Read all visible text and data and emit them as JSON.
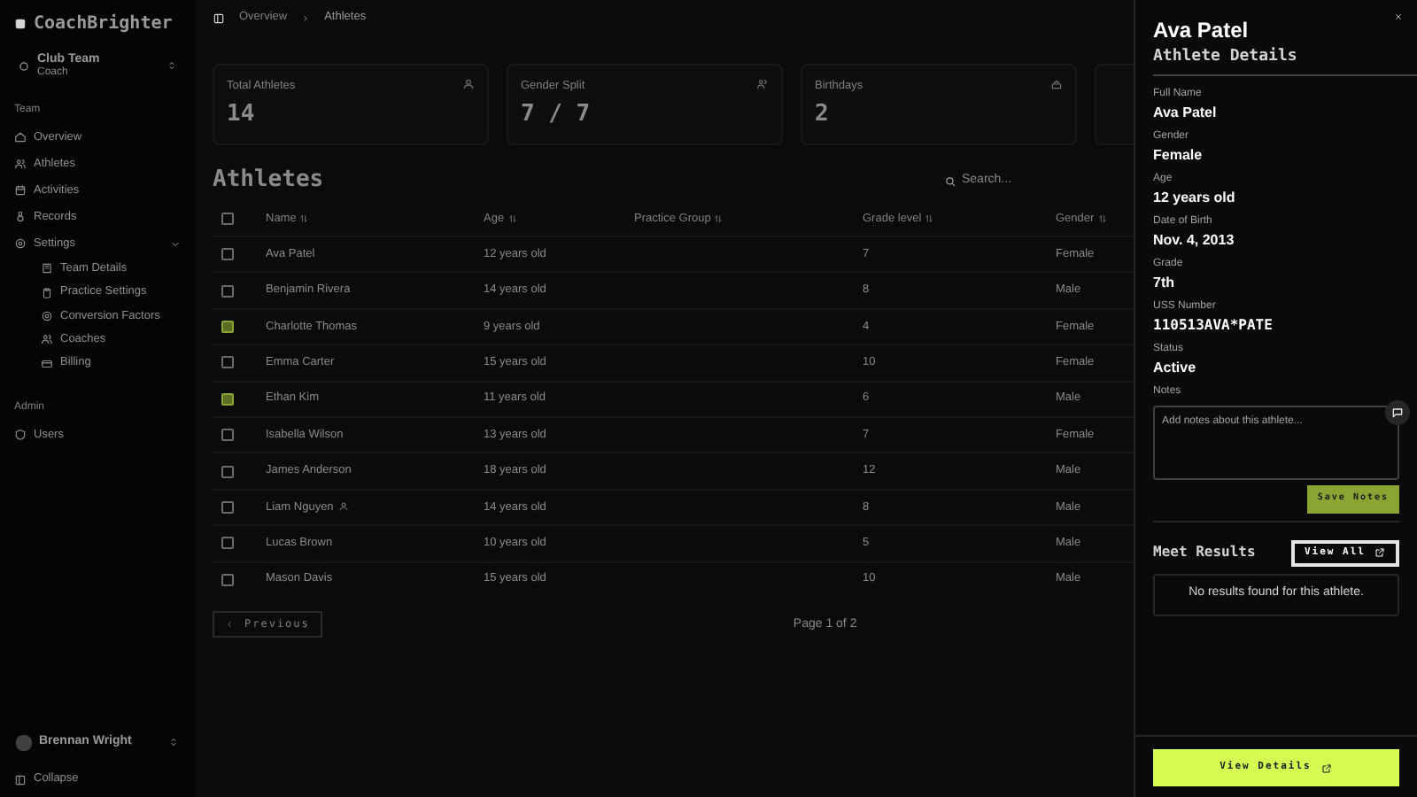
{
  "sidebar": {
    "brand": "CoachBrighter",
    "team": {
      "name": "Club Team",
      "role": "Coach"
    },
    "sections": [
      {
        "label": "Team",
        "items": [
          {
            "label": "Overview"
          },
          {
            "label": "Athletes"
          },
          {
            "label": "Activities"
          },
          {
            "label": "Records"
          },
          {
            "label": "Settings",
            "expanded": true,
            "children": [
              {
                "label": "Team Details"
              },
              {
                "label": "Practice Settings"
              },
              {
                "label": "Conversion Factors"
              },
              {
                "label": "Coaches"
              },
              {
                "label": "Billing"
              }
            ]
          }
        ]
      },
      {
        "label": "Admin",
        "items": [
          {
            "label": "Users"
          }
        ]
      }
    ],
    "user": {
      "name": "Brennan Wright"
    },
    "collapse": "Collapse"
  },
  "breadcrumb": [
    "Overview",
    "Athletes"
  ],
  "stats": [
    {
      "title": "Total Athletes",
      "value": "14"
    },
    {
      "title": "Gender Split",
      "value": "7 / 7"
    },
    {
      "title": "Birthdays",
      "value": "2"
    }
  ],
  "table": {
    "title": "Athletes",
    "search": {
      "placeholder": "Search..."
    },
    "all_selected": false,
    "columns": [
      "Name",
      "Age",
      "Practice Group",
      "Grade level",
      "Gender"
    ],
    "rows": [
      {
        "cells": [
          "Ava Patel",
          "12 years old",
          "",
          "7",
          "Female"
        ],
        "selected": false,
        "linked": false
      },
      {
        "cells": [
          "Benjamin Rivera",
          "14 years old",
          "",
          "8",
          "Male"
        ],
        "selected": false,
        "linked": false
      },
      {
        "cells": [
          "Charlotte Thomas",
          "9 years old",
          "",
          "4",
          "Female"
        ],
        "selected": true,
        "linked": false
      },
      {
        "cells": [
          "Emma Carter",
          "15 years old",
          "",
          "10",
          "Female"
        ],
        "selected": false,
        "linked": false
      },
      {
        "cells": [
          "Ethan Kim",
          "11 years old",
          "",
          "6",
          "Male"
        ],
        "selected": true,
        "linked": false
      },
      {
        "cells": [
          "Isabella Wilson",
          "13 years old",
          "",
          "7",
          "Female"
        ],
        "selected": false,
        "linked": false
      },
      {
        "cells": [
          "James Anderson",
          "18 years old",
          "",
          "12",
          "Male"
        ],
        "selected": false,
        "linked": false
      },
      {
        "cells": [
          "Liam Nguyen",
          "14 years old",
          "",
          "8",
          "Male"
        ],
        "selected": false,
        "linked": true
      },
      {
        "cells": [
          "Lucas Brown",
          "10 years old",
          "",
          "5",
          "Male"
        ],
        "selected": false,
        "linked": false
      },
      {
        "cells": [
          "Mason Davis",
          "15 years old",
          "",
          "10",
          "Male"
        ],
        "selected": false,
        "linked": false
      }
    ],
    "previous": "Previous",
    "page": "Page 1 of 2"
  },
  "panel": {
    "title": "Ava Patel",
    "subtitle": "Athlete Details",
    "fields": [
      {
        "label": "Full Name",
        "value": "Ava Patel"
      },
      {
        "label": "Gender",
        "value": "Female"
      },
      {
        "label": "Age",
        "value": "12 years old"
      },
      {
        "label": "Date of Birth",
        "value": "Nov. 4, 2013"
      },
      {
        "label": "Grade",
        "value": "7th"
      },
      {
        "label": "USS Number",
        "value": "110513AVA*PATE"
      },
      {
        "label": "Status",
        "value": "Active"
      }
    ],
    "notes": {
      "label": "Notes",
      "placeholder": "Add notes about this athlete..."
    },
    "save": "Save Notes",
    "meet_results": {
      "title": "Meet Results",
      "view_all": "View All",
      "empty": "No results found for this athlete."
    },
    "view_details": "View Details"
  }
}
